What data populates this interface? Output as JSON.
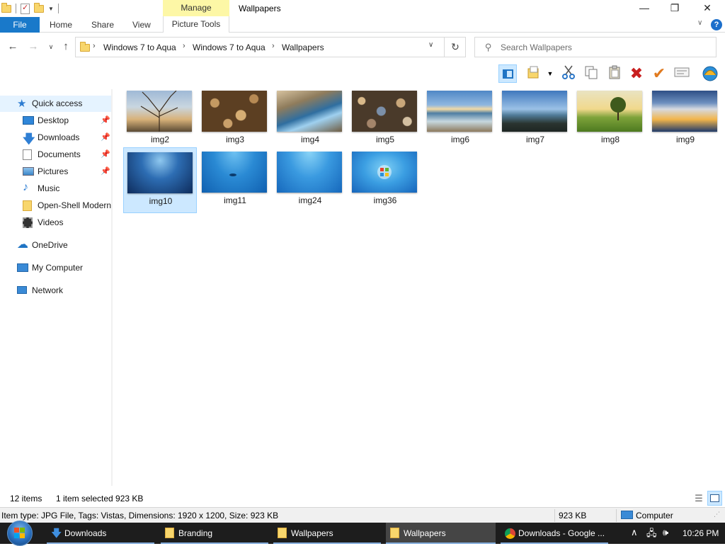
{
  "window": {
    "title": "Wallpapers",
    "context_tab_group": "Manage",
    "minimize_glyph": "—",
    "maximize_glyph": "❐",
    "close_glyph": "✕"
  },
  "ribbon": {
    "file_label": "File",
    "tabs": [
      "Home",
      "Share",
      "View"
    ],
    "context_tab": "Picture Tools",
    "help_glyph": "?"
  },
  "navigation": {
    "breadcrumb": [
      "Windows 7 to Aqua",
      "Windows 7 to Aqua",
      "Wallpapers"
    ],
    "search_placeholder": "Search Wallpapers"
  },
  "sidebar": {
    "items": [
      {
        "label": "Quick access",
        "icon": "star-icon",
        "pinned": false
      },
      {
        "label": "Desktop",
        "icon": "desktop-icon",
        "pinned": true
      },
      {
        "label": "Downloads",
        "icon": "download-icon",
        "pinned": true
      },
      {
        "label": "Documents",
        "icon": "documents-icon",
        "pinned": true
      },
      {
        "label": "Pictures",
        "icon": "pictures-icon",
        "pinned": true
      },
      {
        "label": "Music",
        "icon": "music-icon",
        "pinned": false
      },
      {
        "label": "Open-Shell Modern",
        "icon": "folder-icon",
        "pinned": false
      },
      {
        "label": "Videos",
        "icon": "videos-icon",
        "pinned": false
      },
      {
        "label": "OneDrive",
        "icon": "cloud-icon",
        "pinned": false
      },
      {
        "label": "My Computer",
        "icon": "computer-icon",
        "pinned": false
      },
      {
        "label": "Network",
        "icon": "network-icon",
        "pinned": false
      }
    ]
  },
  "files": [
    {
      "name": "img2",
      "selected": false
    },
    {
      "name": "img3",
      "selected": false
    },
    {
      "name": "img4",
      "selected": false
    },
    {
      "name": "img5",
      "selected": false
    },
    {
      "name": "img6",
      "selected": false
    },
    {
      "name": "img7",
      "selected": false
    },
    {
      "name": "img8",
      "selected": false
    },
    {
      "name": "img9",
      "selected": false
    },
    {
      "name": "img10",
      "selected": true
    },
    {
      "name": "img11",
      "selected": false
    },
    {
      "name": "img24",
      "selected": false
    },
    {
      "name": "img36",
      "selected": false
    }
  ],
  "status": {
    "item_count": "12 items",
    "selection": "1 item selected  923 KB"
  },
  "details": {
    "text": "Item type: JPG File, Tags: Vistas, Dimensions: 1920 x 1200, Size: 923 KB",
    "size": "923 KB",
    "location": "Computer"
  },
  "taskbar": {
    "tasks": [
      {
        "label": "Downloads",
        "icon": "download-icon",
        "active": false
      },
      {
        "label": "Branding",
        "icon": "folder-icon",
        "active": false
      },
      {
        "label": "Wallpapers",
        "icon": "folder-icon",
        "active": false
      },
      {
        "label": "Wallpapers",
        "icon": "folder-icon",
        "active": true
      },
      {
        "label": "Downloads - Google ...",
        "icon": "chrome-icon",
        "active": false
      }
    ],
    "clock": "10:26 PM"
  },
  "colors": {
    "accent": "#1979ca",
    "selection_bg": "#cce8ff",
    "selection_border": "#99d1ff",
    "manage_tab": "#fdf7a6",
    "taskbar": "#1d1d1d"
  }
}
